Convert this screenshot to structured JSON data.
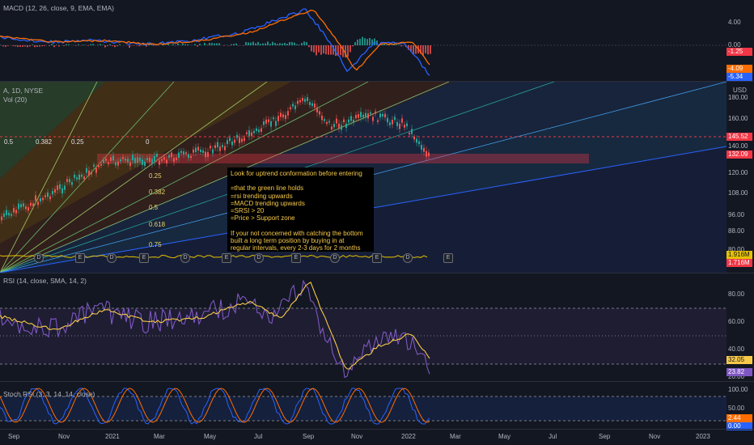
{
  "macd": {
    "title": "MACD (12, 26, close, 9, EMA, EMA)",
    "ticks": [
      "4.00",
      "0.00"
    ],
    "tags": {
      "hist": "-1.25",
      "signal": "-4.09",
      "macd": "-5.34"
    }
  },
  "price": {
    "symbol": "A, 1D, NYSE",
    "vol": "Vol (20)",
    "currency": "USD",
    "ticks": [
      "180.00",
      "160.00",
      "140.00",
      "120.00",
      "108.00",
      "96.00",
      "88.00",
      "80.00"
    ],
    "tags": {
      "support": "145.52",
      "last": "132.09",
      "vol1": "1.916M",
      "vol2": "1.716M"
    },
    "fib_top": [
      "0.5",
      "0.382",
      "0.25",
      "0"
    ],
    "fib_mid": [
      "0.25",
      "0.382",
      "0.5",
      "0.618",
      "0.75"
    ]
  },
  "note": {
    "lines": [
      "Look for uptrend conformation before entering",
      "",
      "=that the green line holds",
      "=rsi trending upwards",
      "=MACD trending upwards",
      "=SRSI > 20",
      "=Price > Support zone",
      "",
      "If your not concerned with catching the bottom",
      "built a long term position by buying in at",
      "regular intervals, every 2-3 days for 2 months"
    ]
  },
  "events": [
    "D",
    "E",
    "D",
    "E",
    "D",
    "E",
    "D",
    "E",
    "D",
    "E",
    "D",
    "E"
  ],
  "rsi": {
    "title": "RSI (14, close, SMA, 14, 2)",
    "ticks": [
      "80.00",
      "60.00",
      "40.00",
      "20.00"
    ],
    "tags": {
      "sma": "32.05",
      "rsi": "23.82"
    }
  },
  "stoch": {
    "title": "Stoch RSI (3, 3, 14, 14, close)",
    "ticks": [
      "100.00",
      "50.00"
    ],
    "tags": {
      "d": "2.44",
      "k": "0.00"
    }
  },
  "xaxis": [
    "Sep",
    "Nov",
    "2021",
    "Mar",
    "May",
    "Jul",
    "Sep",
    "Nov",
    "2022",
    "Mar",
    "May",
    "Jul",
    "Sep",
    "Nov",
    "2023"
  ],
  "colors": {
    "bg": "#131722",
    "red": "#f23645",
    "blue": "#2962ff",
    "orange": "#ff9800",
    "purple": "#7e57c2",
    "yellow": "#f7c948"
  }
}
